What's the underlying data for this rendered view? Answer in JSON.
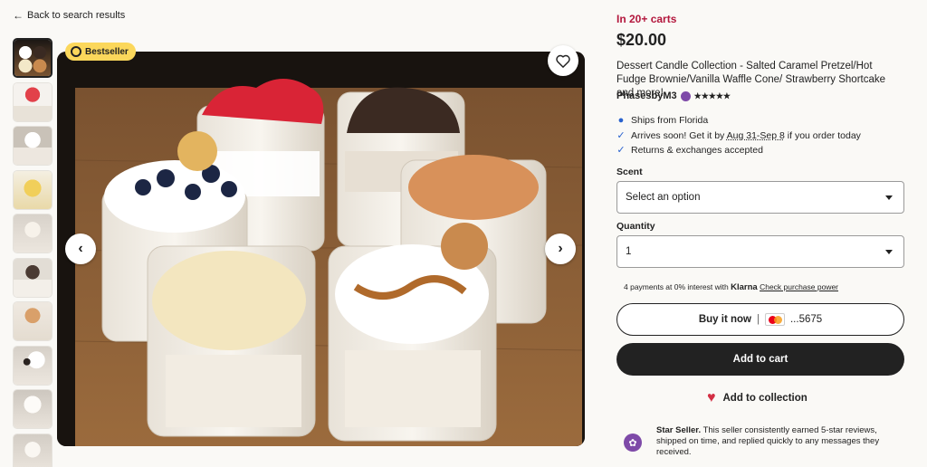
{
  "nav": {
    "back_label": "Back to search results"
  },
  "gallery": {
    "thumb_count": 10,
    "badge_label": "Bestseller"
  },
  "listing": {
    "in_carts": "In 20+ carts",
    "price": "$20.00",
    "title": "Dessert Candle Collection - Salted Caramel Pretzel/Hot Fudge Brownie/Vanilla Waffle Cone/ Strawberry Shortcake and more!",
    "seller_name": "PhasesbyM3",
    "stars": "★★★★★"
  },
  "shipping": {
    "ships_from": "Ships from Florida",
    "arrives_prefix": "Arrives soon! Get it by ",
    "arrives_dates": "Aug 31-Sep 8",
    "arrives_suffix": " if you order today",
    "returns": "Returns & exchanges accepted"
  },
  "options": {
    "scent_label": "Scent",
    "scent_value": "Select an option",
    "quantity_label": "Quantity",
    "quantity_value": "1"
  },
  "klarna": {
    "prefix": "4 payments at 0% interest with ",
    "brand": "Klarna",
    "link": "Check purchase power"
  },
  "actions": {
    "buy_now": "Buy it now",
    "buy_sep": "|",
    "card_last4": "...5675",
    "add_to_cart": "Add to cart",
    "add_to_collection": "Add to collection"
  },
  "star_seller": {
    "title": "Star Seller.",
    "text": " This seller consistently earned 5-star reviews, shipped on time, and replied quickly to any messages they received."
  },
  "colors": {
    "in_carts": "#b3173d",
    "accent_dark": "#222222",
    "star_seller": "#7e4aa8",
    "badge": "#fbd75b",
    "ship_icon": "#2962ce",
    "heart": "#d32f44"
  },
  "icons": {
    "back": "arrow-left-icon",
    "location": "location-pin-icon",
    "check": "check-icon",
    "favorite": "heart-outline-icon",
    "prev": "chevron-left-icon",
    "next": "chevron-right-icon",
    "collection": "heart-filled-icon",
    "medal": "medal-icon"
  }
}
